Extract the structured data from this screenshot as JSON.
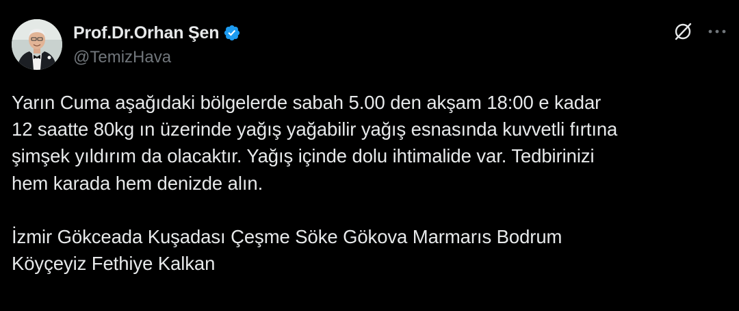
{
  "author": {
    "display_name": "Prof.Dr.Orhan Şen",
    "handle": "@TemizHava",
    "verified": true,
    "avatar_icon": "profile-photo"
  },
  "actions": {
    "grok_icon": "grok-icon",
    "more_icon": "more-icon"
  },
  "tweet": {
    "paragraph1": [
      "Yarın Cuma aşağıdaki bölgelerde sabah 5.00 den akşam 18:00 e kadar",
      "12 saatte 80kg ın üzerinde yağış yağabilir yağış esnasında kuvvetli fırtına",
      "şimşek yıldırım da olacaktır. Yağış içinde dolu ihtimalide var. Tedbirinizi",
      "hem karada hem denizde alın."
    ],
    "paragraph2": [
      "İzmir Gökceada Kuşadası Çeşme Söke Gökova Marmarıs Bodrum",
      "Köyçeyiz Fethiye Kalkan"
    ]
  },
  "colors": {
    "background": "#000000",
    "text_primary": "#e7e9ea",
    "text_secondary": "#71767b",
    "verified_blue": "#1d9bf0"
  }
}
